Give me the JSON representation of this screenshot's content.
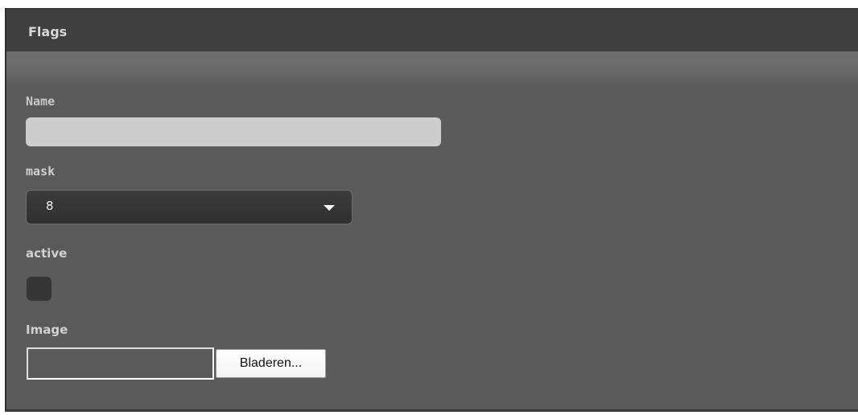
{
  "panel": {
    "title": "Flags"
  },
  "form": {
    "name_label": "Name",
    "name_value": "",
    "mask_label": "mask",
    "mask_value": "8",
    "active_label": "active",
    "active_checked": false,
    "image_label": "Image",
    "browse_label": "Bladeren..."
  }
}
